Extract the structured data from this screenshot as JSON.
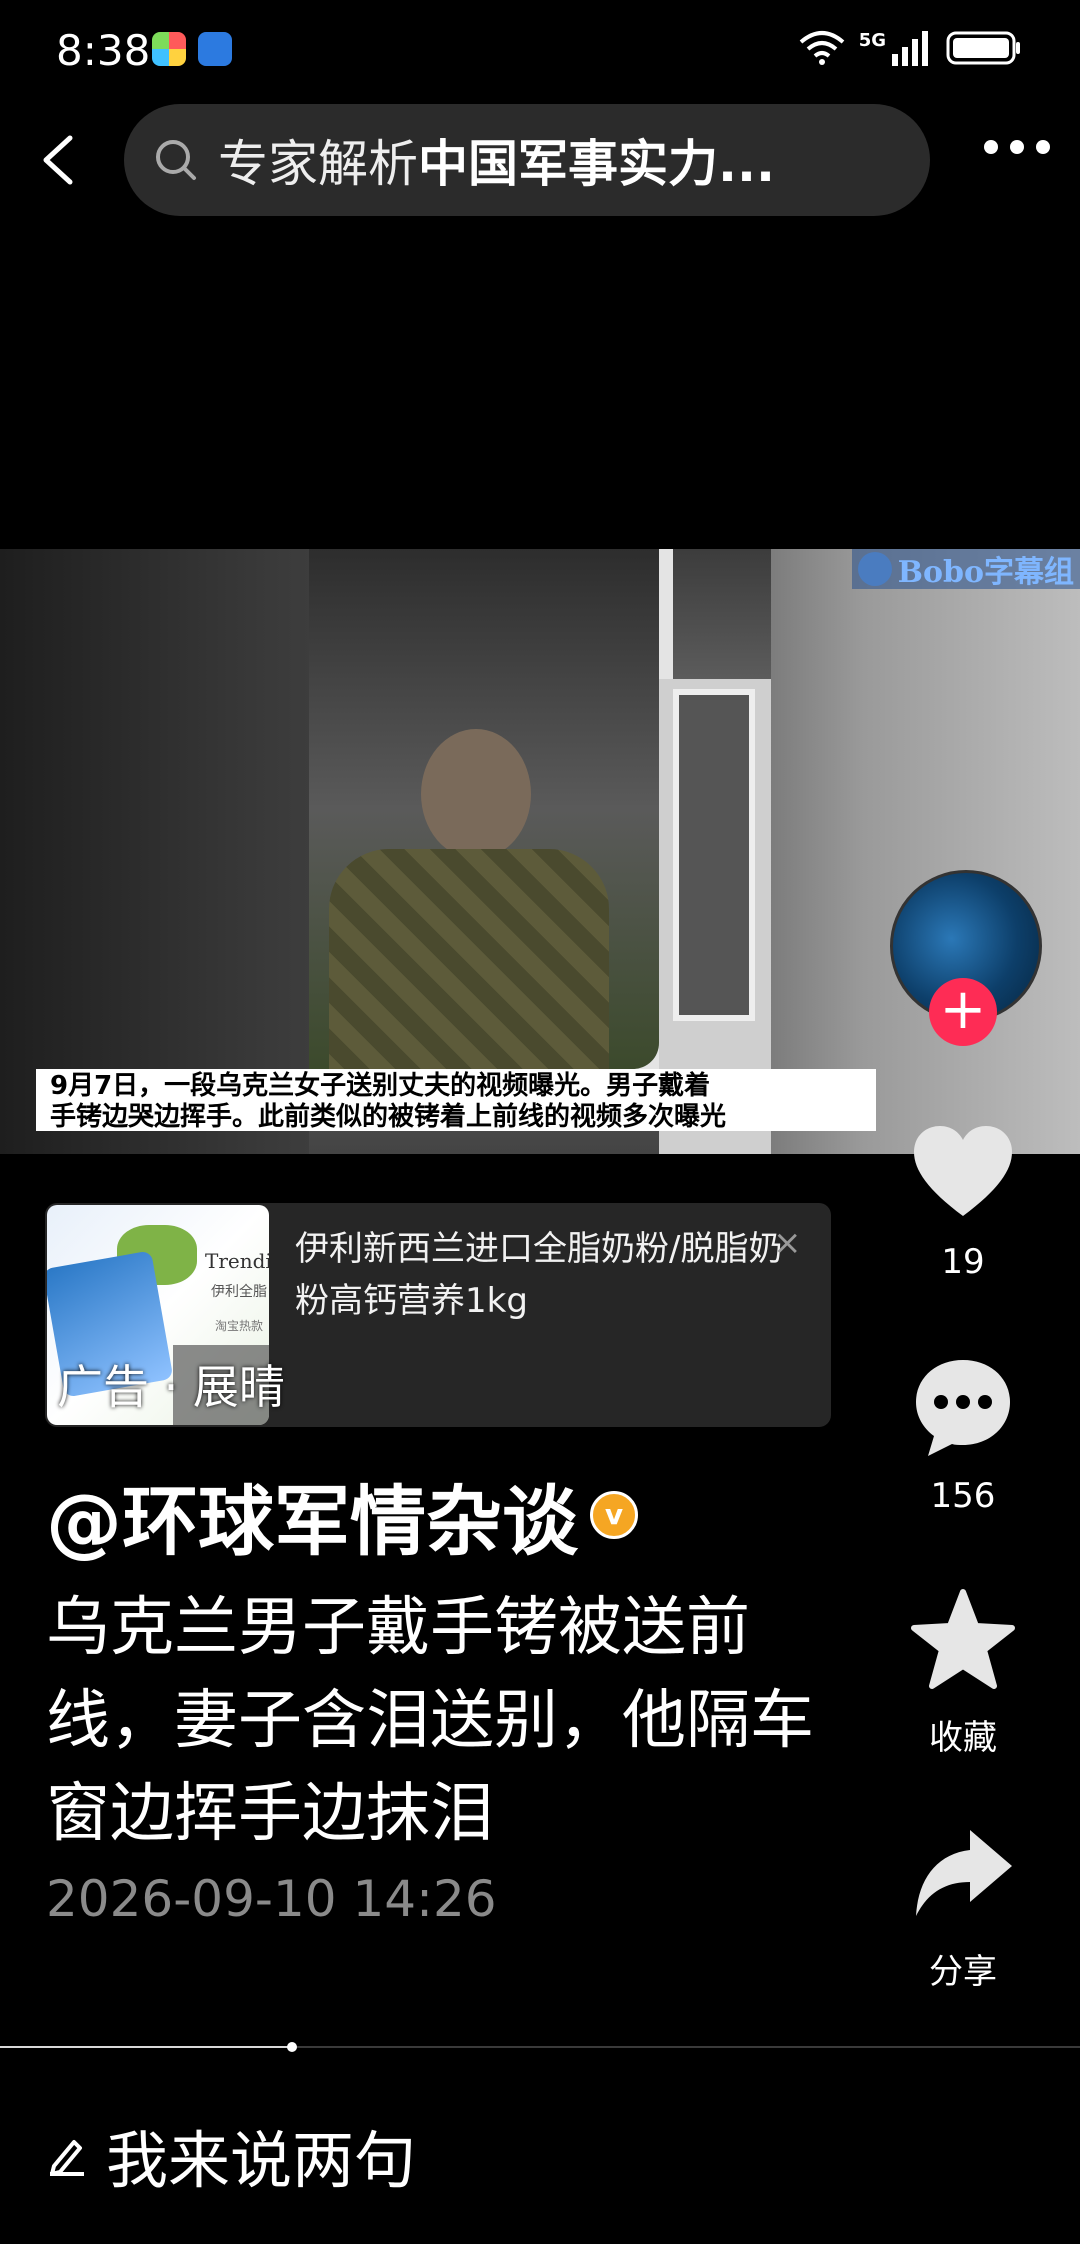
{
  "status_bar": {
    "time": "8:38",
    "network": "5G"
  },
  "search": {
    "text_normal": "专家解析",
    "text_bold": "中国军事实力..."
  },
  "video": {
    "watermark": "Bobo字幕组",
    "caption_line1": "9月7日，一段乌克兰女子送别丈夫的视频曝光。男子戴着",
    "caption_line2": "手铐边哭边挥手。此前类似的被铐着上前线的视频多次曝光",
    "progress_percent": 27
  },
  "rail": {
    "like_count": "19",
    "comment_count": "156",
    "favorite_label": "收藏",
    "share_label": "分享"
  },
  "ad": {
    "thumb_brand": "Trendi",
    "thumb_sub1": "伊利全脂",
    "thumb_sub2": "淘宝热款",
    "label": "广告 · 展晴",
    "title": "伊利新西兰进口全脂奶粉/脱脂奶粉高钙营养1kg",
    "close": "×"
  },
  "post": {
    "author": "@环球军情杂谈",
    "verified_mark": "v",
    "title": "乌克兰男子戴手铐被送前线，妻子含泪送别，他隔车窗边挥手边抹泪",
    "time": "2026-09-10 14:26"
  },
  "comment_bar": {
    "placeholder": "我来说两句"
  },
  "colors": {
    "background": "#000000",
    "accent": "#fe2c55",
    "verified": "#f5a623"
  }
}
